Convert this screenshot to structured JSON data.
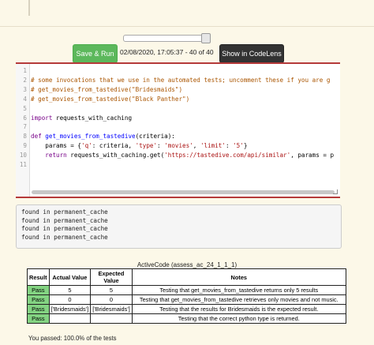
{
  "toolbar": {
    "run_label": "Save & Run",
    "timestamp": "02/08/2020, 17:05:37 - 40 of 40",
    "codelens_label": "Show in CodeLens"
  },
  "slider": {
    "value_fraction": 1.0
  },
  "editor": {
    "lines": [
      {
        "n": "1",
        "html": ""
      },
      {
        "n": "2",
        "html": "<span class='cm'># some invocations that we use in the automated tests; uncomment these if you are g</span>"
      },
      {
        "n": "3",
        "html": "<span class='cm'># get_movies_from_tastedive(\"Bridesmaids\")</span>"
      },
      {
        "n": "4",
        "html": "<span class='cm'># get_movies_from_tastedive(\"Black Panther\")</span>"
      },
      {
        "n": "5",
        "html": ""
      },
      {
        "n": "6",
        "html": "<span class='kw'>import</span> requests_with_caching"
      },
      {
        "n": "7",
        "html": ""
      },
      {
        "n": "8",
        "html": "<span class='kw'>def</span> <span class='df'>get_movies_from_tastedive</span>(criteria):"
      },
      {
        "n": "9",
        "html": "    params = {<span class='st'>'q'</span>: criteria, <span class='st'>'type'</span>: <span class='st'>'movies'</span>, <span class='st'>'limit'</span>: <span class='st'>'5'</span>}"
      },
      {
        "n": "10",
        "html": "    <span class='kw'>return</span> requests_with_caching.get(<span class='st'>'https://tastedive.com/api/similar'</span>, params = p"
      },
      {
        "n": "11",
        "html": ""
      }
    ]
  },
  "output": {
    "lines": [
      "found in permanent_cache",
      "found in permanent_cache",
      "found in permanent_cache",
      "found in permanent_cache"
    ]
  },
  "results": {
    "caption": "ActiveCode (assess_ac_24_1_1_1)",
    "headers": [
      "Result",
      "Actual Value",
      "Expected Value",
      "Notes"
    ],
    "rows": [
      [
        "Pass",
        "5",
        "5",
        "Testing that get_movies_from_tastedive returns only 5 results"
      ],
      [
        "Pass",
        "0",
        "0",
        "Testing that get_movies_from_tastedive retrieves only movies and not music."
      ],
      [
        "Pass",
        "['Bridesmaids']",
        "['Bridesmaids']",
        "Testing that the results for Bridesmaids is the expected result."
      ],
      [
        "Pass",
        "",
        "",
        "Testing that the correct python type is returned."
      ]
    ],
    "summary": "You passed: 100.0% of the tests"
  }
}
